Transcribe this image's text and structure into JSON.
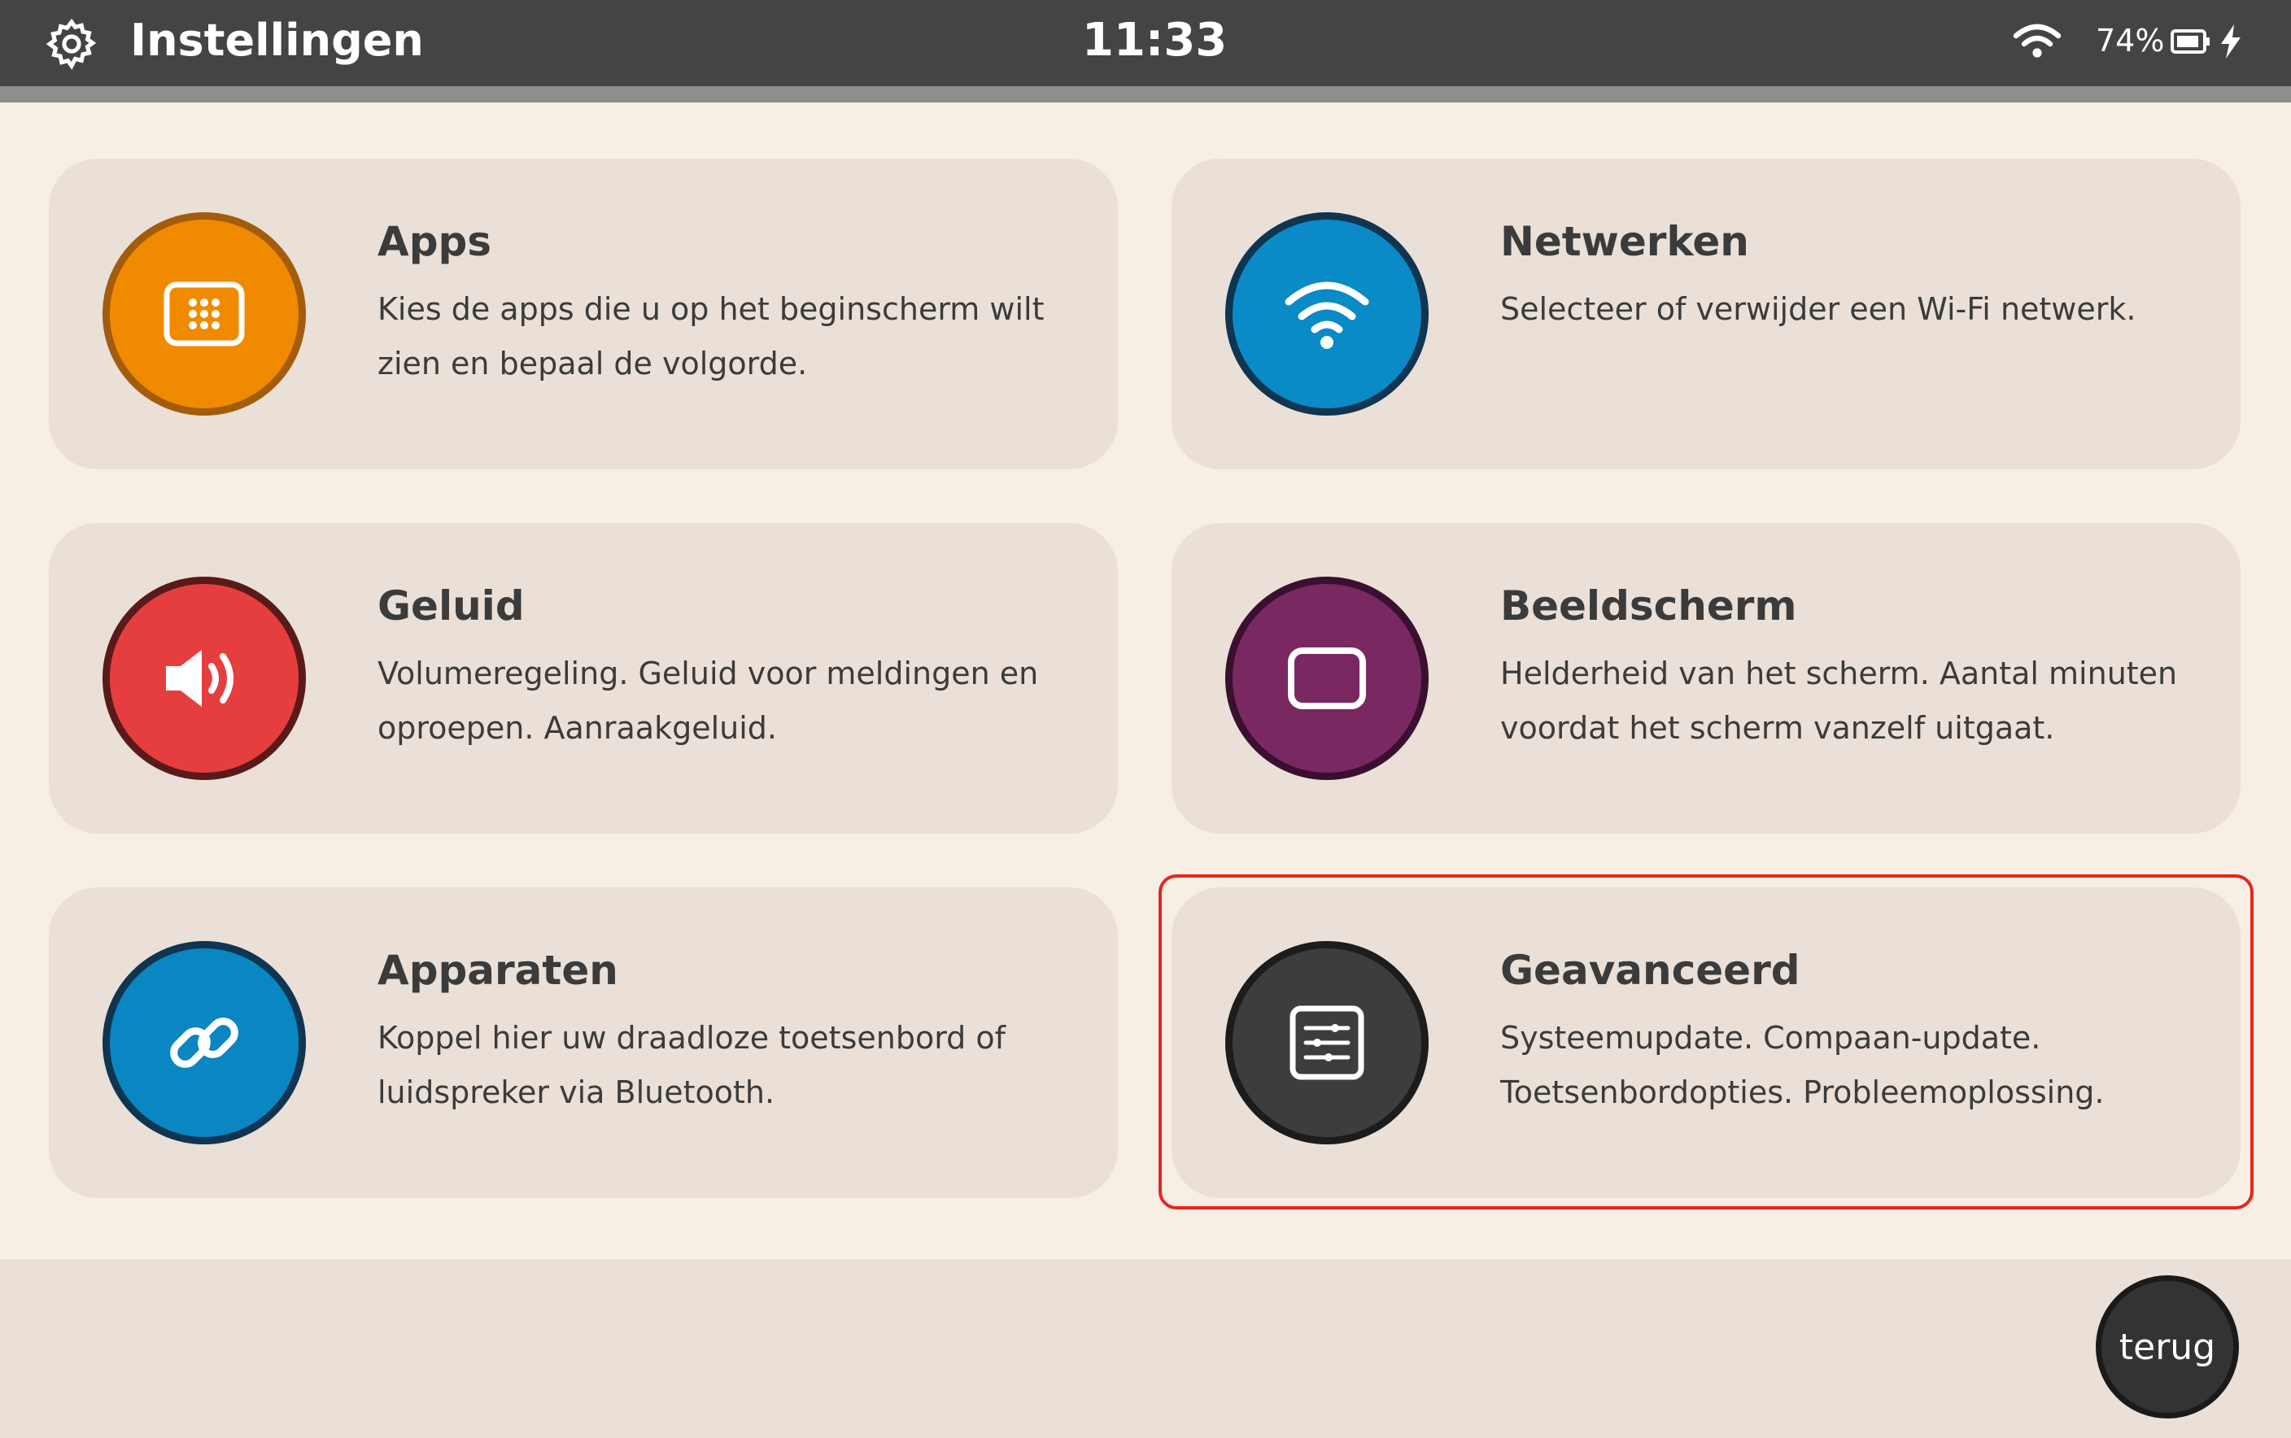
{
  "statusbar": {
    "title": "Instellingen",
    "time": "11:33",
    "battery": "74%"
  },
  "cards": [
    {
      "title": "Apps",
      "desc": "Kies de apps die u op het beginscherm wilt zien en bepaal de volgorde.",
      "color": "#f08a00",
      "ring": "#a25c0c",
      "icon": "apps-grid-icon"
    },
    {
      "title": "Netwerken",
      "desc": "Selecteer of verwijder een Wi-Fi netwerk.",
      "color": "#0a8ac6",
      "ring": "#0f3550",
      "icon": "wifi-icon"
    },
    {
      "title": "Geluid",
      "desc": "Volumeregeling. Geluid voor meldingen en oproepen. Aanraakgeluid.",
      "color": "#e63e3e",
      "ring": "#5a1a1a",
      "icon": "speaker-icon"
    },
    {
      "title": "Beeldscherm",
      "desc": "Helderheid van het scherm. Aantal minuten voordat het scherm vanzelf uitgaat.",
      "color": "#7a2862",
      "ring": "#3a1030",
      "icon": "screen-icon"
    },
    {
      "title": "Apparaten",
      "desc": "Koppel hier uw draadloze toetsenbord of luidspreker via Bluetooth.",
      "color": "#0a86c2",
      "ring": "#0f3550",
      "icon": "link-icon"
    },
    {
      "title": "Geavanceerd",
      "desc": "Systeemupdate. Compaan-update. Toetsenbordopties. Probleemoplossing.",
      "color": "#3d3d3d",
      "ring": "#1c1c1c",
      "icon": "sliders-icon"
    }
  ],
  "back_label": "terug",
  "colors": {
    "highlight": "#e8251d",
    "topbar": "#444444",
    "background": "#f7efe5",
    "card": "#eae0d7"
  }
}
